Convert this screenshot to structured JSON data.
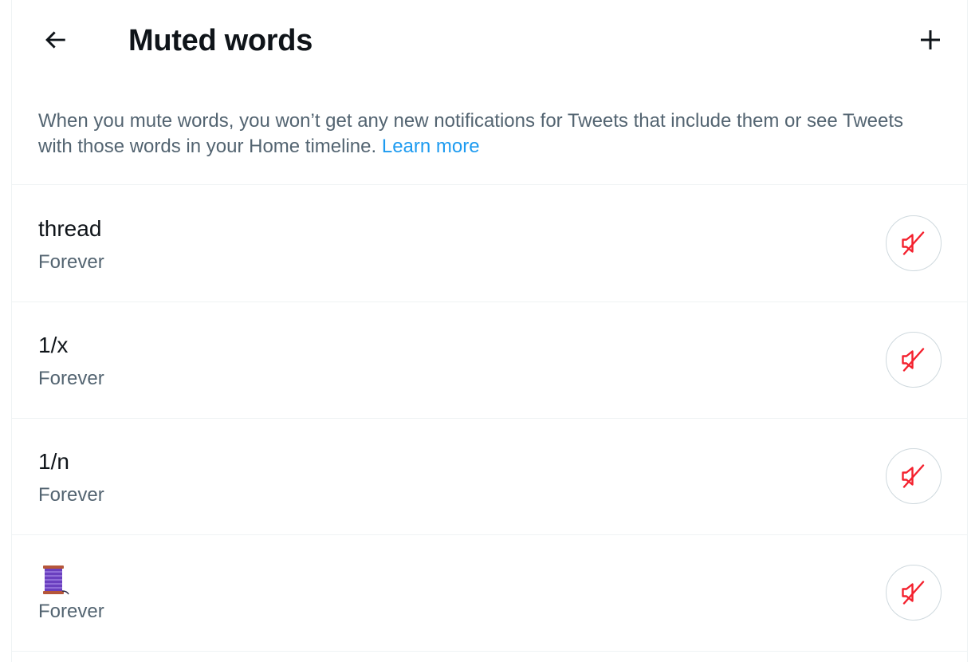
{
  "header": {
    "title": "Muted words",
    "back_icon": "arrow-left-icon",
    "add_icon": "plus-icon"
  },
  "description": {
    "text": "When you mute words, you won’t get any new notifications for Tweets that include them or see Tweets with those words in your Home timeline.",
    "link_label": "Learn more"
  },
  "muted_words": [
    {
      "word": "thread",
      "duration": "Forever",
      "icon": "speaker-muted-icon"
    },
    {
      "word": "1/x",
      "duration": "Forever",
      "icon": "speaker-muted-icon"
    },
    {
      "word": "1/n",
      "duration": "Forever",
      "icon": "speaker-muted-icon"
    },
    {
      "word": "🧵",
      "duration": "Forever",
      "icon": "speaker-muted-icon"
    }
  ],
  "colors": {
    "text_primary": "#0f1419",
    "text_secondary": "#536471",
    "link": "#1d9bf0",
    "unmute_icon": "#f4212e",
    "divider": "#eff3f4"
  }
}
